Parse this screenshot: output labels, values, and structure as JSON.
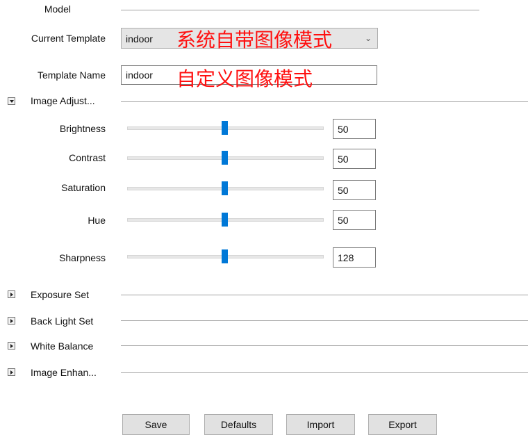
{
  "model": {
    "label": "Model"
  },
  "template": {
    "current_label": "Current Template",
    "current_value": "indoor",
    "current_annotation": "系统自带图像模式",
    "name_label": "Template Name",
    "name_value": "indoor",
    "name_annotation": "自定义图像模式"
  },
  "image_adjust": {
    "title": "Image Adjust...",
    "sliders": [
      {
        "label": "Brightness",
        "value": "50"
      },
      {
        "label": "Contrast",
        "value": "50"
      },
      {
        "label": "Saturation",
        "value": "50"
      },
      {
        "label": "Hue",
        "value": "50"
      },
      {
        "label": "Sharpness",
        "value": "128"
      }
    ]
  },
  "sections": [
    {
      "title": "Exposure Set"
    },
    {
      "title": "Back Light Set"
    },
    {
      "title": "White Balance"
    },
    {
      "title": "Image Enhan..."
    }
  ],
  "buttons": {
    "save": "Save",
    "defaults": "Defaults",
    "import": "Import",
    "export": "Export"
  },
  "icons": {
    "dropdown": "chevron-down-icon",
    "expanded": "triangle-down-icon",
    "collapsed": "triangle-right-icon"
  },
  "colors": {
    "accent": "#0078d7",
    "annotation": "#ff1010"
  }
}
